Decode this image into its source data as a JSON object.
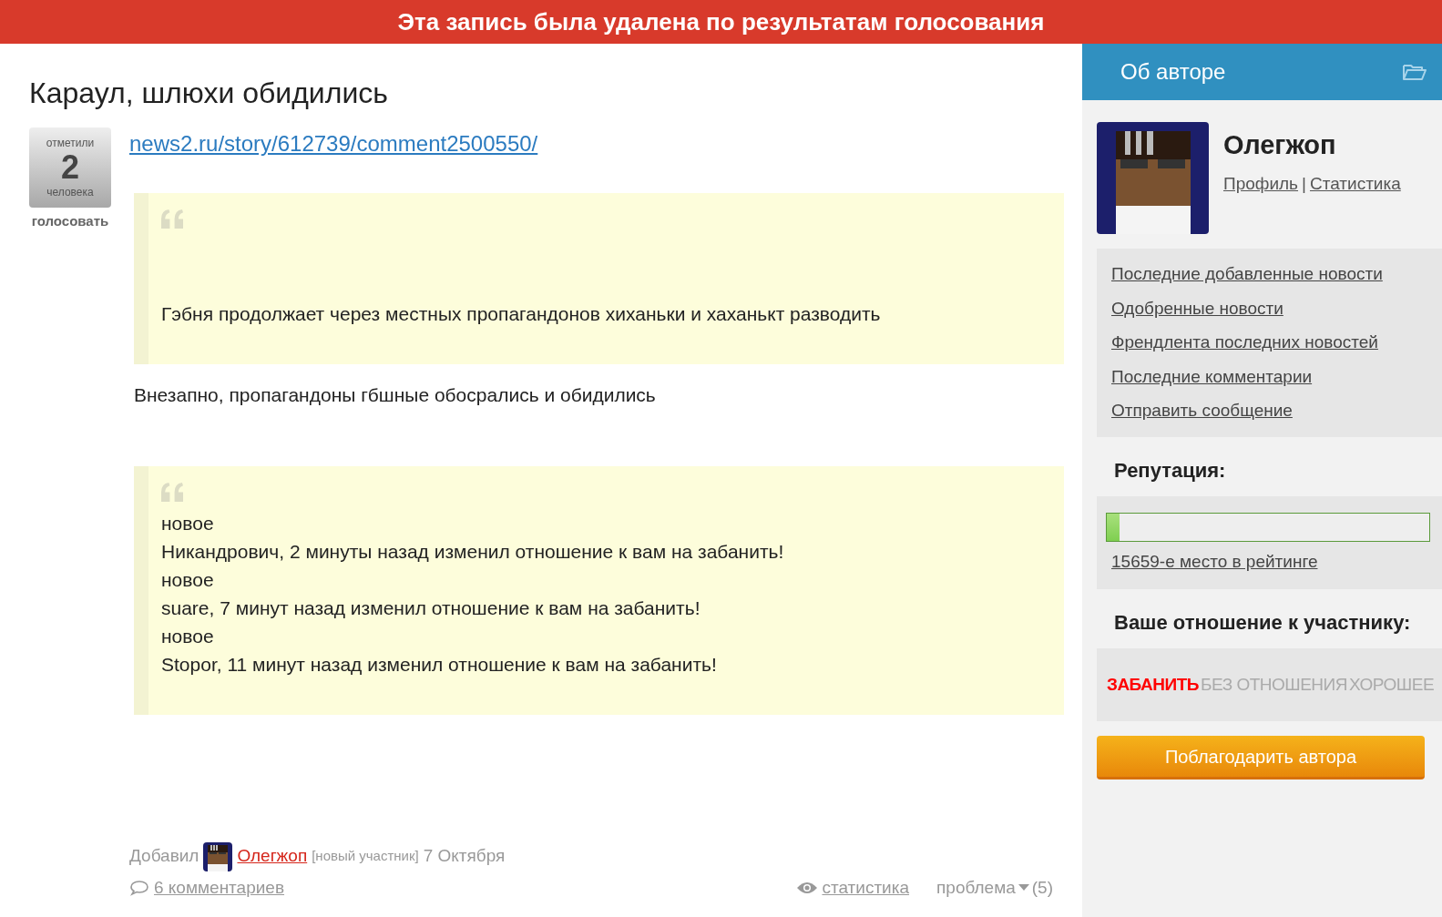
{
  "banner": "Эта запись была удалена по результатам голосования",
  "post": {
    "title": "Караул, шлюхи обидились",
    "votes": {
      "top": "отметили",
      "count": "2",
      "bottom": "человека",
      "action": "голосовать"
    },
    "link": "news2.ru/story/612739/comment2500550/",
    "blocks": [
      {
        "kind": "quote",
        "lines": [
          "Гэбня продолжает через местных пропагандонов хиханьки и хаханькт разводить"
        ]
      },
      {
        "kind": "text",
        "lines": [
          "Внезапно, пропагандоны гбшные обосрались и обидились"
        ]
      },
      {
        "kind": "quote",
        "lines": [
          "новое",
          "Никандрович, 2 минуты назад изменил отношение к вам на забанить!",
          "новое",
          "suare, 7 минут назад изменил отношение к вам на забанить!",
          "новое",
          "Stopor, 11 минут назад изменил отношение к вам на забанить!"
        ]
      }
    ],
    "footer": {
      "added": "Добавил",
      "author": "Олегжоп",
      "status": "[новый участник]",
      "date": "7 Октября",
      "comments": "6 комментариев",
      "stats": "статистика",
      "problem": "проблема",
      "problem_count": "(5)"
    }
  },
  "sidebar": {
    "title": "Об авторе",
    "name": "Олегжоп",
    "profile": "Профиль",
    "separator": "|",
    "statistics": "Статистика",
    "links": [
      "Последние добавленные новости",
      "Одобренные новости",
      "Френдлента последних новостей",
      "Последние комментарии",
      "Отправить сообщение"
    ],
    "reputation_title": "Репутация:",
    "reputation": {
      "level": 0.04
    },
    "rank": "15659-е место в рейтинге",
    "relation_title": "Ваше отношение к участнику:",
    "relations": [
      {
        "label": "ЗАБАНИТЬ",
        "selected": true
      },
      {
        "label": "БЕЗ ОТНОШЕНИЯ",
        "selected": false
      },
      {
        "label": "ХОРОШЕЕ",
        "selected": false
      }
    ],
    "thank_button": "Поблагодарить автора"
  }
}
